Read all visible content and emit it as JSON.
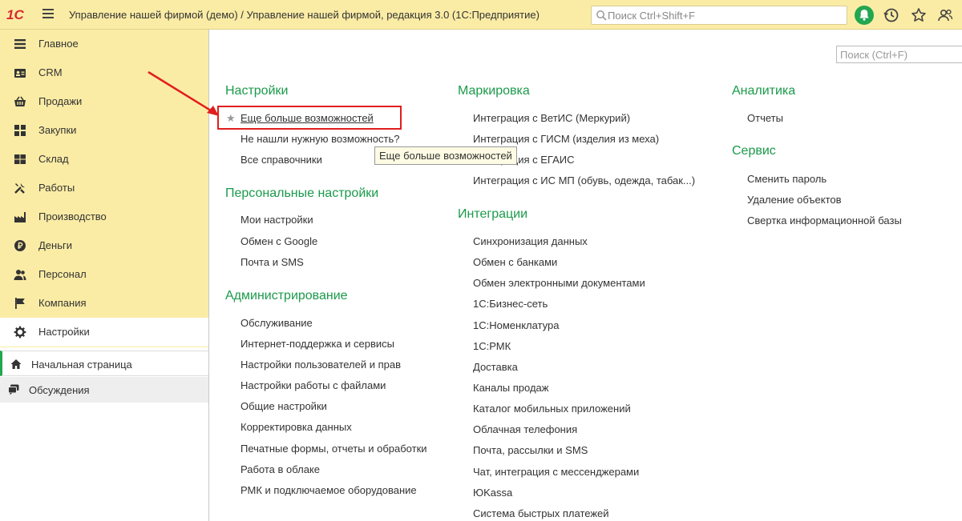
{
  "titlebar": {
    "logo": "1С",
    "title": "Управление нашей фирмой (демо) / Управление нашей фирмой, редакция 3.0  (1С:Предприятие)",
    "search_placeholder": "Поиск Ctrl+Shift+F"
  },
  "sidebar": {
    "items": [
      {
        "label": "Главное",
        "icon": "menu-icon"
      },
      {
        "label": "CRM",
        "icon": "contact-card-icon"
      },
      {
        "label": "Продажи",
        "icon": "basket-icon"
      },
      {
        "label": "Закупки",
        "icon": "purchase-icon"
      },
      {
        "label": "Склад",
        "icon": "warehouse-icon"
      },
      {
        "label": "Работы",
        "icon": "tools-icon"
      },
      {
        "label": "Производство",
        "icon": "factory-icon"
      },
      {
        "label": "Деньги",
        "icon": "ruble-icon"
      },
      {
        "label": "Персонал",
        "icon": "people-icon"
      },
      {
        "label": "Компания",
        "icon": "flag-icon"
      },
      {
        "label": "Настройки",
        "icon": "gear-icon"
      }
    ],
    "home": "Начальная страница",
    "discussions": "Обсуждения"
  },
  "main": {
    "search_placeholder": "Поиск (Ctrl+F)",
    "tooltip": "Еще больше возможностей",
    "columns": [
      {
        "sections": [
          {
            "title": "Настройки",
            "links": [
              "Еще больше возможностей",
              "Не нашли нужную возможность?",
              "Все справочники"
            ]
          },
          {
            "title": "Персональные настройки",
            "links": [
              "Мои настройки",
              "Обмен с Google",
              "Почта и SMS"
            ]
          },
          {
            "title": "Администрирование",
            "links": [
              "Обслуживание",
              "Интернет-поддержка и сервисы",
              "Настройки пользователей и прав",
              "Настройки работы с файлами",
              "Общие настройки",
              "Корректировка данных",
              "Печатные формы, отчеты и обработки",
              "Работа в облаке",
              "РМК и подключаемое оборудование"
            ]
          }
        ]
      },
      {
        "sections": [
          {
            "title": "Маркировка",
            "links": [
              "Интеграция с ВетИС (Меркурий)",
              "Интеграция с ГИСМ (изделия из меха)",
              "Интеграция с ЕГАИС",
              "Интеграция с ИС МП (обувь, одежда, табак...)"
            ]
          },
          {
            "title": "Интеграции",
            "links": [
              "Синхронизация данных",
              "Обмен с банками",
              "Обмен электронными документами",
              "1С:Бизнес-сеть",
              "1С:Номенклатура",
              "1С:РМК",
              "Доставка",
              "Каналы продаж",
              "Каталог мобильных приложений",
              "Облачная телефония",
              "Почта, рассылки и SMS",
              "Чат, интеграция с мессенджерами",
              "ЮKassa",
              "Система быстрых платежей"
            ]
          }
        ]
      },
      {
        "sections": [
          {
            "title": "Аналитика",
            "links": [
              "Отчеты"
            ]
          },
          {
            "title": "Сервис",
            "links": [
              "Сменить пароль",
              "Удаление объектов",
              "Свертка информационной базы"
            ]
          }
        ]
      }
    ]
  },
  "colors": {
    "accent": "#1b9a4b",
    "sidebar_bg": "#fbeca5",
    "highlight": "#e01e1e"
  }
}
